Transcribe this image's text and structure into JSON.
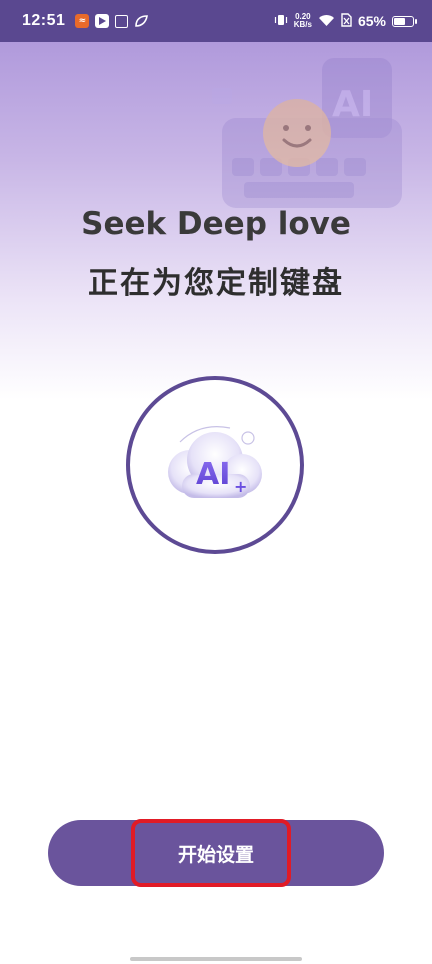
{
  "status_bar": {
    "time": "12:51",
    "notification_icons": [
      "xiaohongshu-like-icon",
      "video-play-icon",
      "box-app-icon",
      "leaf-app-icon"
    ],
    "net_speed_value": "0.20",
    "net_speed_unit": "KB/s",
    "battery_percent": "65%",
    "battery_level": 0.65
  },
  "main": {
    "title_en": "Seek Deep love",
    "title_zh": "正在为您定制键盘",
    "illustration_text": "AI"
  },
  "footer": {
    "start_button_label": "开始设置"
  },
  "colors": {
    "accent": "#6a549c",
    "circle_border": "#5d4a94",
    "status_bar": "#5a4890",
    "highlight": "#e11b26"
  }
}
